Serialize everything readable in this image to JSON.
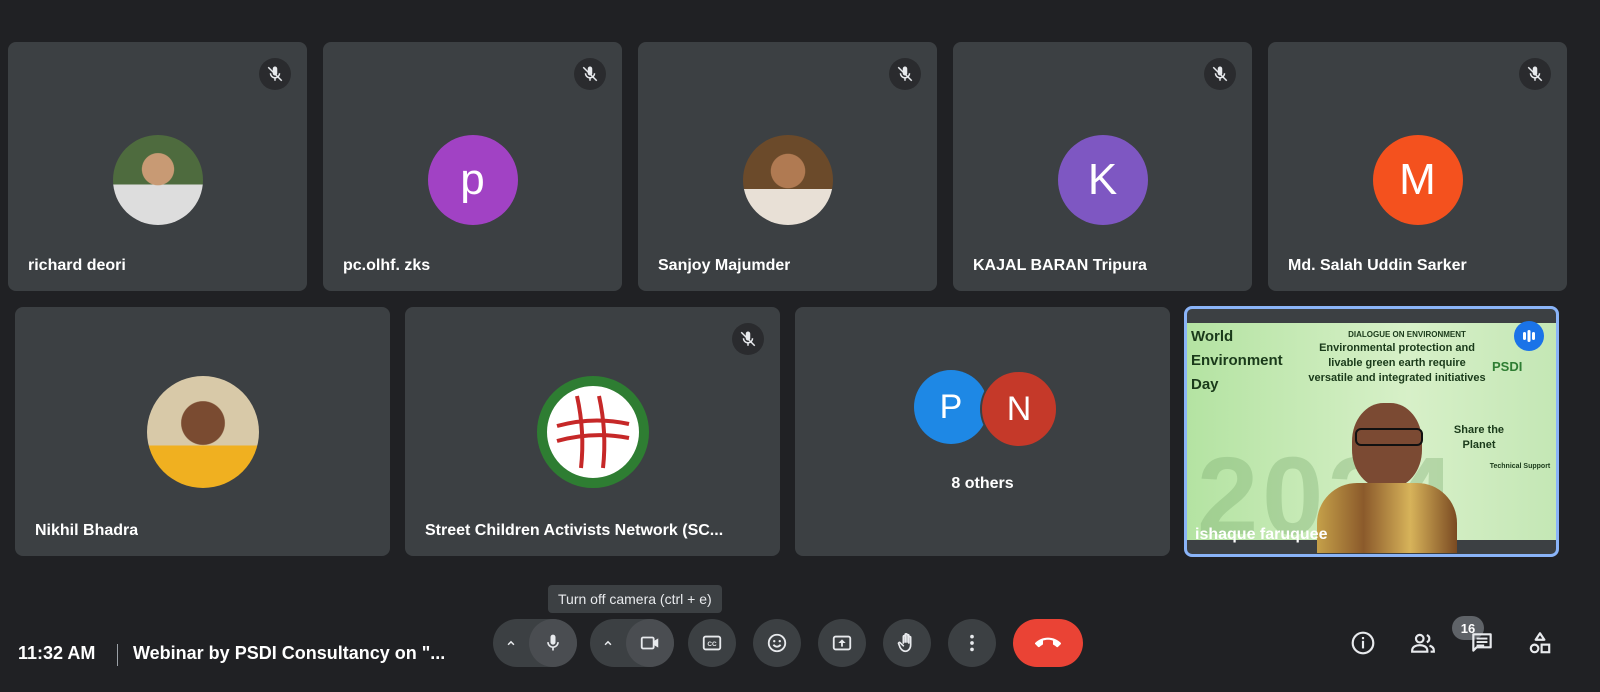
{
  "participants_row1": [
    {
      "name": "richard deori",
      "avatar": "photo",
      "muted": true
    },
    {
      "name": "pc.olhf. zks",
      "avatar_letter": "p",
      "avatar_color": "#a142c4",
      "muted": true
    },
    {
      "name": "Sanjoy Majumder",
      "avatar": "photo",
      "muted": true
    },
    {
      "name": "KAJAL BARAN Tripura",
      "avatar_letter": "K",
      "avatar_color": "#7e57c2",
      "muted": true
    },
    {
      "name": "Md. Salah Uddin Sarker",
      "avatar_letter": "M",
      "avatar_color": "#f4511e",
      "muted": true
    }
  ],
  "participants_row2": [
    {
      "name": "Nikhil Bhadra",
      "avatar": "photo",
      "muted": false
    },
    {
      "name": "Street Children Activists Network (SC...",
      "avatar": "logo",
      "muted": true
    },
    {
      "name": "8 others",
      "avatar_letters": [
        "P",
        "N"
      ],
      "avatar_colors": [
        "#1e88e5",
        "#c53929"
      ]
    },
    {
      "name": "ishaque faruquee",
      "speaking": true,
      "self_view": true
    }
  ],
  "self_view_text": {
    "banner_title": "DIALOGUE ON ENVIRONMENT",
    "banner_lines": [
      "Environmental protection and",
      "livable green earth require",
      "versatile and integrated initiatives"
    ],
    "left_words": [
      "World",
      "Environment",
      "Day"
    ],
    "big_text": "2024",
    "side_words": [
      "PSDI",
      "Share the Planet",
      "Technical Support"
    ]
  },
  "tooltip": "Turn off camera (ctrl + e)",
  "bottom_bar": {
    "time": "11:32 AM",
    "meeting_title": "Webinar by PSDI Consultancy on \"...",
    "participant_count": "16"
  },
  "icons": {
    "mic": "mic-icon",
    "camera": "camera-icon",
    "captions": "captions-icon",
    "emoji": "emoji-icon",
    "present": "present-icon",
    "hand": "raise-hand-icon",
    "more": "more-vert-icon",
    "end": "end-call-icon",
    "info": "info-icon",
    "people": "people-icon",
    "chat": "chat-icon",
    "activities": "activities-icon"
  }
}
